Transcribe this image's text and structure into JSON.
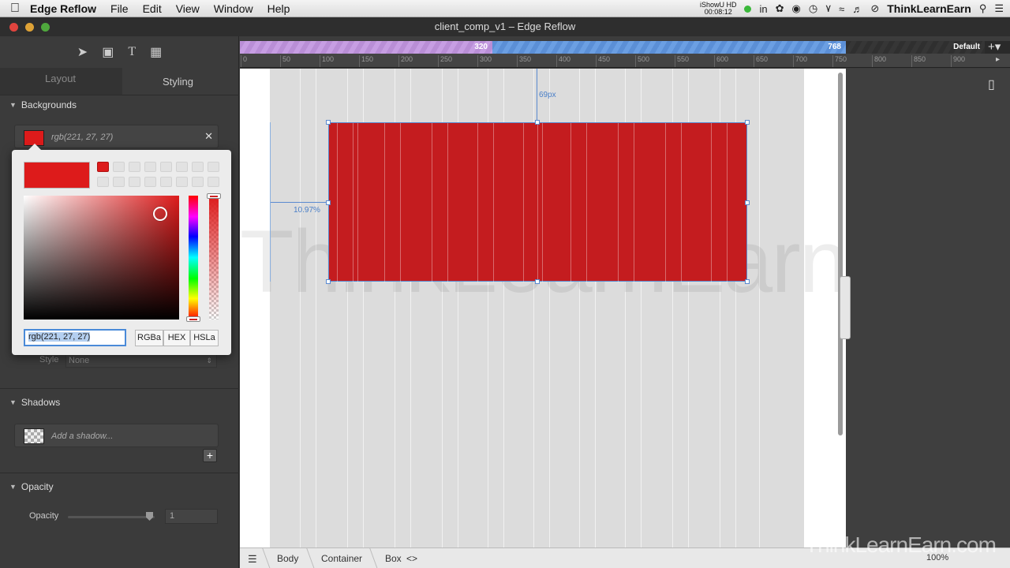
{
  "menubar": {
    "app_name": "Edge Reflow",
    "menus": [
      "File",
      "Edit",
      "View",
      "Window",
      "Help"
    ],
    "recorder_name": "iShowU HD",
    "recorder_time": "00:08:12",
    "user": "ThinkLearnEarn"
  },
  "window": {
    "title": "client_comp_v1 – Edge Reflow"
  },
  "left_panel": {
    "tab_layout": "Layout",
    "tab_styling": "Styling",
    "backgrounds_title": "Backgrounds",
    "background_value": "rgb(221, 27, 27)",
    "border_style_label": "Style",
    "border_style_value": "None",
    "shadows_title": "Shadows",
    "shadow_placeholder": "Add a shadow...",
    "opacity_title": "Opacity",
    "opacity_label": "Opacity",
    "opacity_value": "1"
  },
  "color_picker": {
    "input_value": "rgb(221, 27, 27)",
    "mode_rgba": "RGBa",
    "mode_hex": "HEX",
    "mode_hsla": "HSLa",
    "current_color": "#dd1b1b"
  },
  "ruler": {
    "breakpoint_1": "320",
    "breakpoint_2": "768",
    "breakpoint_default": "Default",
    "ticks": [
      "0",
      "50",
      "100",
      "150",
      "200",
      "250",
      "300",
      "350",
      "400",
      "450",
      "500",
      "550",
      "600",
      "650",
      "700",
      "750",
      "800",
      "850",
      "900"
    ]
  },
  "canvas": {
    "top_measure": "69px",
    "left_measure": "10.97%",
    "watermark": "ThinkLearnEarn.com",
    "box_color": "#c41c1f"
  },
  "statusbar": {
    "crumbs": [
      "Body",
      "Container",
      "Box"
    ],
    "zoom": "100%"
  },
  "corner_watermark": "ThinkLearnEarn.com"
}
